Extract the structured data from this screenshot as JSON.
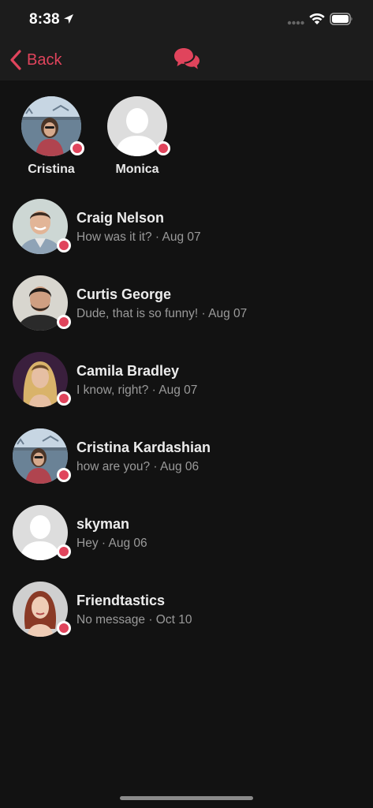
{
  "status_bar": {
    "time": "8:38",
    "icons": [
      "location-arrow-icon",
      "cellular-signal-icon",
      "wifi-icon",
      "battery-icon"
    ]
  },
  "nav": {
    "back_label": "Back",
    "logo_icon": "chat-bubbles-icon",
    "accent_color": "#e0445c"
  },
  "stories": [
    {
      "name": "Cristina",
      "online": true,
      "avatar": "photo-woman-bridge"
    },
    {
      "name": "Monica",
      "online": true,
      "avatar": "placeholder-person"
    }
  ],
  "conversations": [
    {
      "name": "Craig Nelson",
      "message": "How was it it?",
      "date": "Aug 07",
      "online": true,
      "avatar": "photo-man-smiling"
    },
    {
      "name": "Curtis George",
      "message": "Dude, that is so funny!",
      "date": "Aug 07",
      "online": true,
      "avatar": "photo-man-beard"
    },
    {
      "name": "Camila Bradley",
      "message": "I know, right?",
      "date": "Aug 07",
      "online": true,
      "avatar": "photo-woman-blonde"
    },
    {
      "name": "Cristina Kardashian",
      "message": "how are you?",
      "date": "Aug 06",
      "online": true,
      "avatar": "photo-woman-bridge"
    },
    {
      "name": "skyman",
      "message": "Hey",
      "date": "Aug 06",
      "online": true,
      "avatar": "placeholder-person"
    },
    {
      "name": "Friendtastics",
      "message": "No message",
      "date": "Oct 10",
      "online": true,
      "avatar": "photo-woman-redhead"
    }
  ]
}
